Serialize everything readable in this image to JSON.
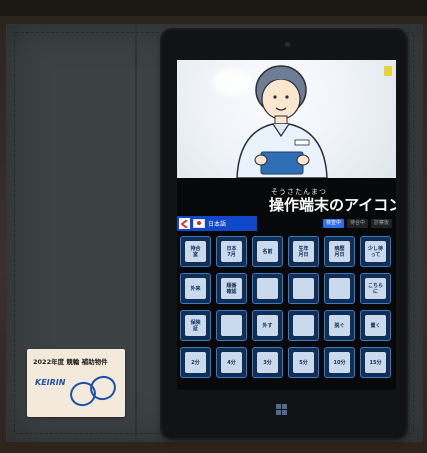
{
  "tablet_app": {
    "title_furigana": "そうさたんまつ",
    "title": "操作端末のアイコン",
    "language": {
      "label": "日本語"
    },
    "filters": [
      "検査中",
      "待合中",
      "診察後"
    ],
    "tiles": [
      "待合\n室",
      "日本\n7月",
      "名前",
      "生年\n月日",
      "病歴\n月日",
      "少し待\nって",
      "外来",
      "順番\n確認",
      "",
      "",
      "",
      "こちら\nに",
      "保険\n証",
      "",
      "外す",
      "",
      "脱ぐ",
      "置く",
      "2分",
      "4分",
      "3分",
      "5分",
      "10分",
      "15分"
    ]
  },
  "sticker": {
    "caption": "2022年度 競輪 補助物件",
    "brand": "KEIRIN"
  },
  "colors": {
    "case": "#3c4144",
    "screen_bg": "#070809",
    "tile_border": "#3f79c2",
    "lang_bar": "#1148c9",
    "chip_active": "#2e6ee6"
  },
  "icons": {
    "back_arrow": "chevron-left-icon",
    "flag": "japan-flag-icon",
    "windows_button": "windows-logo-icon"
  }
}
